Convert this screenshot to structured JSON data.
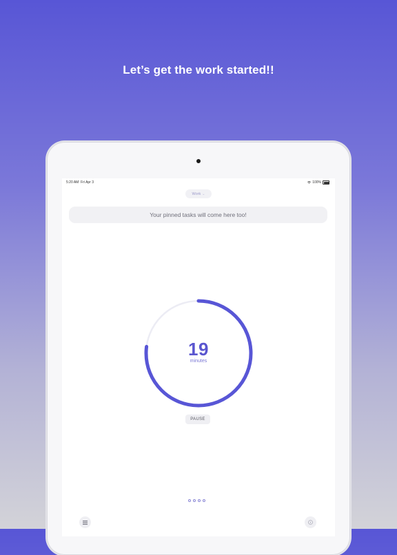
{
  "headline": "Let’s get the work started!!",
  "status_bar": {
    "time": "5:20 AM",
    "date": "Fri Apr 3",
    "battery": "100%"
  },
  "mode_selector": {
    "label": "Work",
    "icon": "chevron-down-icon"
  },
  "pinned_banner": {
    "text": "Your pinned tasks will come here too!"
  },
  "timer": {
    "value": "19",
    "unit": "minutes",
    "progress": 0.77,
    "accent_color": "#5856d6",
    "track_color": "#ececf4"
  },
  "pause_button": {
    "label": "PAUSE"
  },
  "pager": {
    "count": 4,
    "active_index": 0
  },
  "bottom_bar": {
    "left_icon": "list-icon",
    "right_icon": "info-icon"
  }
}
